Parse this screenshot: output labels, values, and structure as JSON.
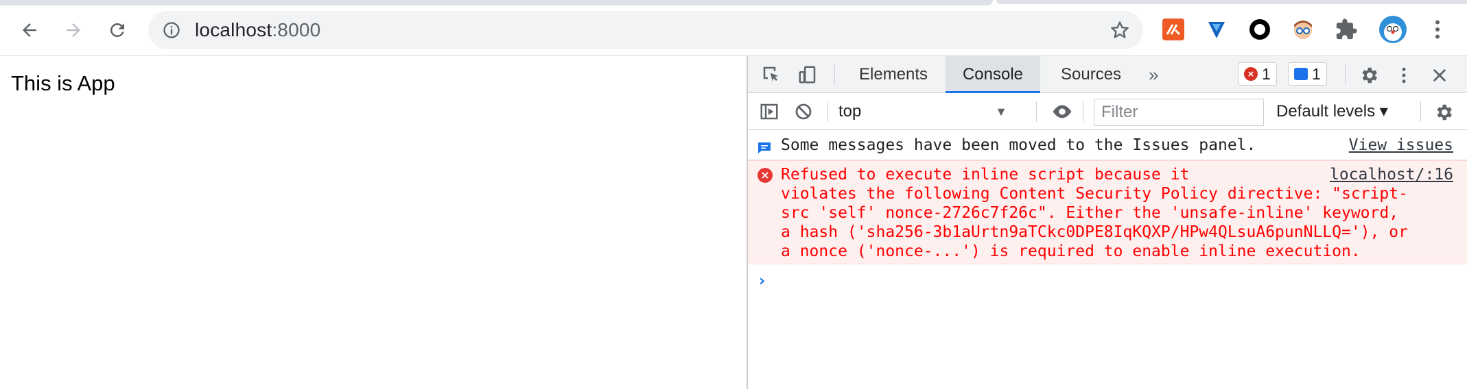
{
  "browser": {
    "url_host": "localhost",
    "url_port": ":8000",
    "extensions": [
      "postman-extension-icon",
      "fork-extension-icon",
      "circle-extension-icon",
      "face-extension-icon",
      "puzzle-extensions-icon",
      "profile-avatar"
    ]
  },
  "page": {
    "text": "This is App"
  },
  "devtools": {
    "tabs": [
      "Elements",
      "Console",
      "Sources"
    ],
    "active_tab": "Console",
    "more_tabs": "»",
    "error_count": "1",
    "info_count": "1",
    "context": "top",
    "filter_placeholder": "Filter",
    "levels": "Default levels ▾",
    "messages": {
      "info_text": "Some messages have been moved to the Issues panel.",
      "info_link": "View issues",
      "error_text": "Refused to execute inline script because it\nviolates the following Content Security Policy directive: \"script-\nsrc 'self' nonce-2726c7f26c\". Either the 'unsafe-inline' keyword,\na hash ('sha256-3b1aUrtn9aTCkc0DPE8IqKQXP/HPw4QLsuA6punNLLQ='), or\na nonce ('nonce-...') is required to enable inline execution.",
      "error_source": "localhost/:16"
    },
    "prompt": "›"
  },
  "colors": {
    "accent": "#1a73e8",
    "error": "#ff0000",
    "error_bg": "#fff0f0"
  }
}
